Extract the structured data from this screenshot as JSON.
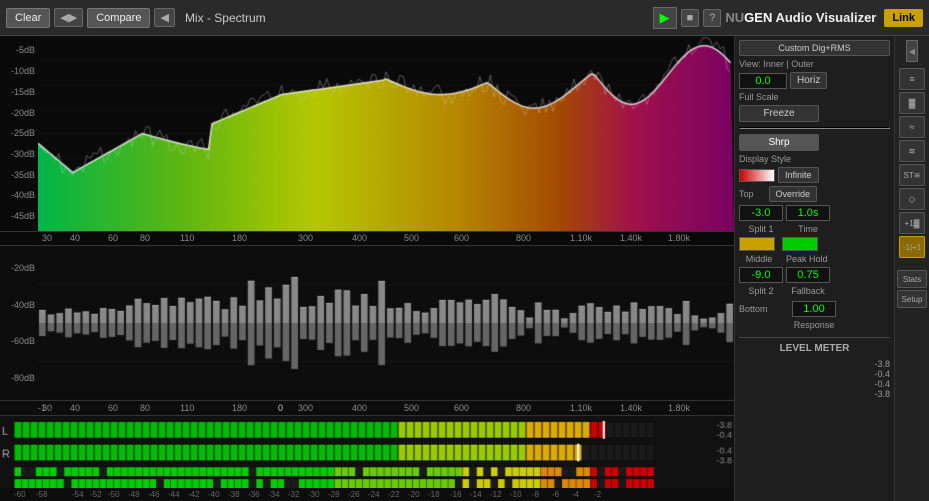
{
  "topbar": {
    "clear_label": "Clear",
    "compare_label": "Compare",
    "title": "Mix - Spectrum",
    "play_icon": "▶",
    "stop_icon": "■",
    "help_icon": "?",
    "nugen_text": "NUGEN Audio Visualizer",
    "link_label": "Link"
  },
  "controls": {
    "custom_dig_rms": "Custom Dig+RMS",
    "view_label": "View: Inner | Outer",
    "value_0": "0.0",
    "horiz_label": "Horiz",
    "full_scale": "Full Scale",
    "freeze_label": "Freeze",
    "shrp_label": "Shrp",
    "display_style": "Display Style",
    "infinite_label": "Infinite",
    "override_label": "Override",
    "top_label": "Top",
    "split1_value": "-3.0",
    "split1_label": "Split 1",
    "time_value": "1.0s",
    "time_label": "Time",
    "middle_label": "Middle",
    "peak_label": "Peak",
    "peak_hold_label": "Peak Hold",
    "split2_value": "-9.0",
    "split2_label": "Split 2",
    "fallback_value": "0.75",
    "fallback_label": "Fallback",
    "bottom_label": "Bottom",
    "response_value": "1.00",
    "response_label": "Response",
    "level_meter": "LEVEL METER",
    "db_values": [
      "-5dB",
      "-10dB",
      "-15dB",
      "-20dB",
      "-25dB",
      "-30dB",
      "-35dB",
      "-40dB",
      "-45dB"
    ],
    "hist_db_values": [
      "-20dB",
      "-40dB",
      "-60dB",
      "-80dB"
    ],
    "hist_db_values2": [
      "-80dB",
      "-60dB",
      "-40dB",
      "-20dB"
    ],
    "freq_labels": [
      "30",
      "40",
      "60",
      "80",
      "110",
      "180",
      "300",
      "400",
      "500",
      "600",
      "800",
      "1.10k",
      "1.40k",
      "1.80k"
    ],
    "minus1_label": "-1"
  },
  "strip": {
    "buttons": [
      "≡",
      "▓",
      "≈",
      "≋",
      "ST",
      "◇",
      "+1",
      "-1",
      "Stats",
      "Setup"
    ]
  },
  "meter_scale": [
    "-60",
    "-58",
    "-54",
    "-52",
    "-50",
    "-48",
    "-46",
    "-44",
    "-42",
    "-40",
    "-38",
    "-36",
    "-34",
    "-32",
    "-30",
    "-28",
    "-26",
    "-24",
    "-22",
    "-20",
    "-18",
    "-16",
    "-14",
    "-12",
    "-10",
    "-8",
    "-6",
    "-4",
    "-2"
  ],
  "right_db_values": [
    "-3.8",
    "-0.4",
    "-0.4",
    "-3.8"
  ]
}
